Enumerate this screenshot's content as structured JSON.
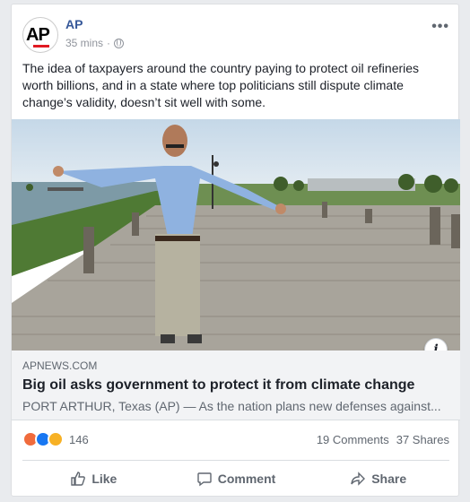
{
  "post": {
    "author": "AP",
    "logo_text": "AP",
    "time": "35 mins",
    "separator": "·",
    "more": "•••",
    "text": "The idea of taxpayers around the country paying to protect oil refineries worth billions, and in a state where top politicians still dispute climate change’s validity, doesn’t sit well with some."
  },
  "link": {
    "domain": "APNEWS.COM",
    "title": "Big oil asks government to protect it from climate change",
    "description": "PORT ARTHUR, Texas (AP) — As the nation plans new defenses against..."
  },
  "info_label": "i",
  "stats": {
    "reaction_count": "146",
    "comments": "19 Comments",
    "shares": "37 Shares"
  },
  "actions": {
    "like": "Like",
    "comment": "Comment",
    "share": "Share"
  },
  "colors": {
    "accent": "#365899",
    "angry": "#f06b3c",
    "like": "#1877f2",
    "haha": "#f7b125"
  }
}
